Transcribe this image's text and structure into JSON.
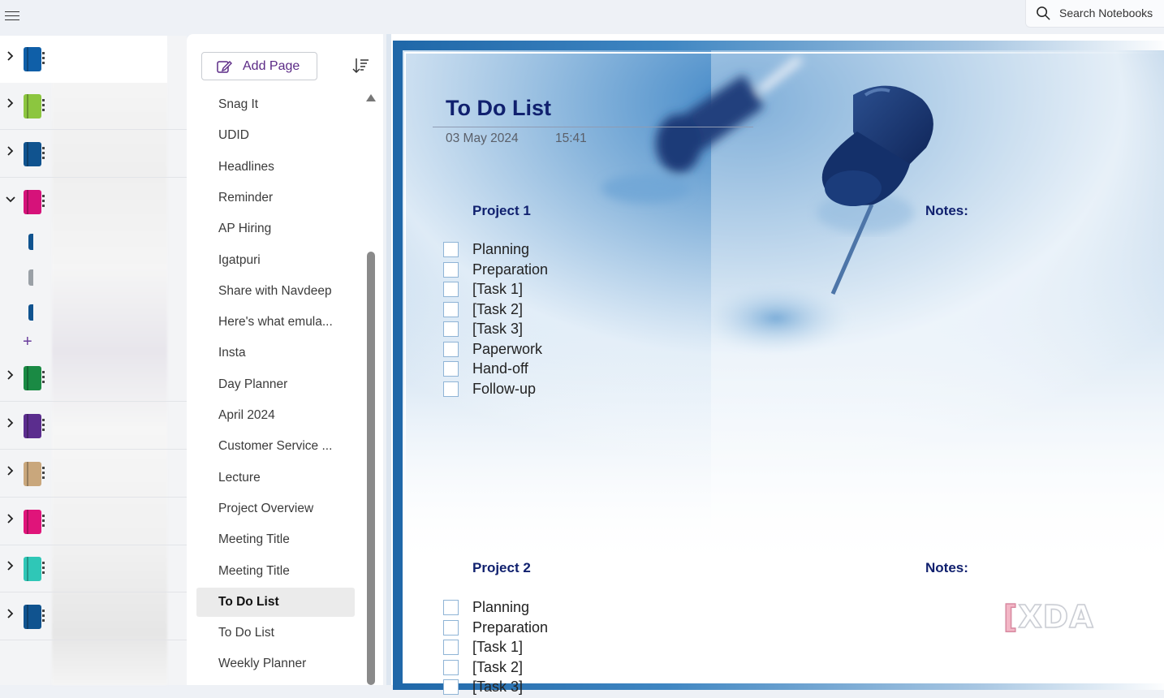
{
  "topbar": {
    "search_label": "Search Notebooks"
  },
  "notebooks": {
    "items": [
      {
        "color": "#0f5fa8",
        "expanded": false
      },
      {
        "color": "#8cc63f",
        "expanded": false
      },
      {
        "color": "#10538f",
        "expanded": false
      },
      {
        "color": "#d6127a",
        "expanded": true
      },
      {
        "color": "#1a8a44",
        "expanded": false
      },
      {
        "color": "#5b2d8e",
        "expanded": false
      },
      {
        "color": "#c9a77c",
        "expanded": false
      },
      {
        "color": "#e0147a",
        "expanded": false
      },
      {
        "color": "#2fc7b7",
        "expanded": false
      },
      {
        "color": "#10538f",
        "expanded": false
      }
    ],
    "sections": [
      {
        "color": "#10538f"
      },
      {
        "color": "#9aa0a6"
      },
      {
        "color": "#10538f"
      }
    ],
    "add_section": "+"
  },
  "pages": {
    "add_page_label": "Add Page",
    "items": [
      "Snag It",
      "UDID",
      "Headlines",
      "Reminder",
      "AP Hiring",
      "Igatpuri",
      "Share with Navdeep",
      "Here's what emula...",
      "Insta",
      "Day Planner",
      "April 2024",
      "Customer Service ...",
      "Lecture",
      "Project Overview",
      "Meeting Title",
      "Meeting Title",
      "To Do List",
      "To Do List",
      "Weekly Planner"
    ],
    "active_index": 16
  },
  "note": {
    "title": "To Do List",
    "date": "03 May 2024",
    "time": "15:41",
    "projects": [
      {
        "heading": "Project 1",
        "notes_label": "Notes:",
        "tasks": [
          "Planning",
          "Preparation",
          "[Task 1]",
          "[Task 2]",
          "[Task 3]",
          "Paperwork",
          "Hand-off",
          "Follow-up"
        ]
      },
      {
        "heading": "Project 2",
        "notes_label": "Notes:",
        "tasks": [
          "Planning",
          "Preparation",
          "[Task 1]",
          "[Task 2]",
          "[Task 3]"
        ]
      }
    ]
  },
  "watermark": {
    "text": "XDA"
  }
}
